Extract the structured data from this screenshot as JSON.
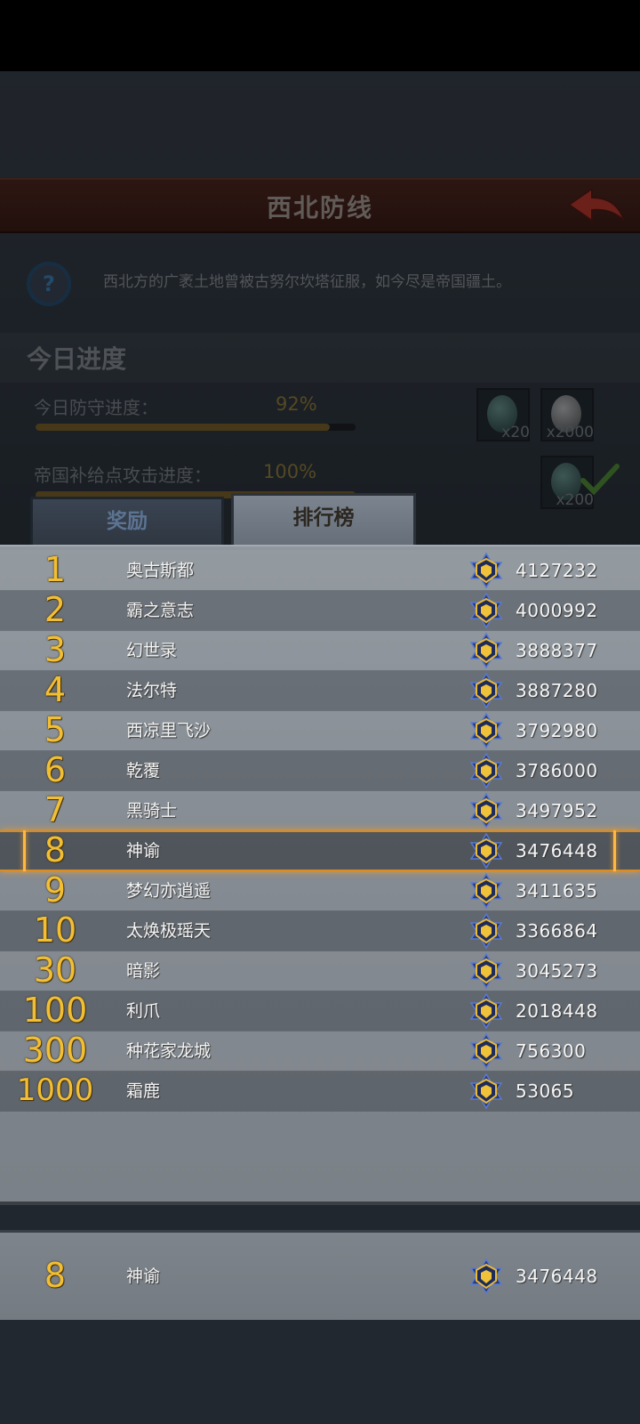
{
  "header": {
    "title": "西北防线"
  },
  "description": "西北方的广袤土地曾被古努尔坎塔征服，如今尽是帝国疆土。",
  "progress": {
    "section_title": "今日进度",
    "rows": [
      {
        "label": "今日防守进度：",
        "percent_text": "92%",
        "percent": 92
      },
      {
        "label": "帝国补给点攻击进度：",
        "percent_text": "100%",
        "percent": 100
      }
    ],
    "rewards": [
      {
        "icon": "teal-gem-icon",
        "qty": "x20"
      },
      {
        "icon": "silver-coin-icon",
        "qty": "x2000"
      },
      {
        "icon": "teal-gem-icon",
        "qty": "x200"
      }
    ]
  },
  "tabs": {
    "rewards": "奖励",
    "ranking": "排行榜",
    "active": "ranking"
  },
  "ranking": [
    {
      "rank": "1",
      "name": "奥古斯都",
      "score": "4127232"
    },
    {
      "rank": "2",
      "name": "霸之意志",
      "score": "4000992"
    },
    {
      "rank": "3",
      "name": "幻世录",
      "score": "3888377"
    },
    {
      "rank": "4",
      "name": "法尔特",
      "score": "3887280"
    },
    {
      "rank": "5",
      "name": "西凉里飞沙",
      "score": "3792980"
    },
    {
      "rank": "6",
      "name": "乾覆",
      "score": "3786000"
    },
    {
      "rank": "7",
      "name": "黑骑士",
      "score": "3497952"
    },
    {
      "rank": "8",
      "name": "神谕",
      "score": "3476448"
    },
    {
      "rank": "9",
      "name": "梦幻亦逍遥",
      "score": "3411635"
    },
    {
      "rank": "10",
      "name": "太焕极瑶天",
      "score": "3366864"
    },
    {
      "rank": "30",
      "name": "暗影",
      "score": "3045273"
    },
    {
      "rank": "100",
      "name": "利爪",
      "score": "2018448"
    },
    {
      "rank": "300",
      "name": "种花家龙城",
      "score": "756300"
    },
    {
      "rank": "1000",
      "name": "霜鹿",
      "score": "53065"
    }
  ],
  "highlight_rank": "8",
  "my_rank": {
    "rank": "8",
    "name": "神谕",
    "score": "3476448"
  },
  "colors": {
    "rank_gold": "#f2bf34",
    "highlight": "#e89a30",
    "panel": "#8a9198"
  }
}
